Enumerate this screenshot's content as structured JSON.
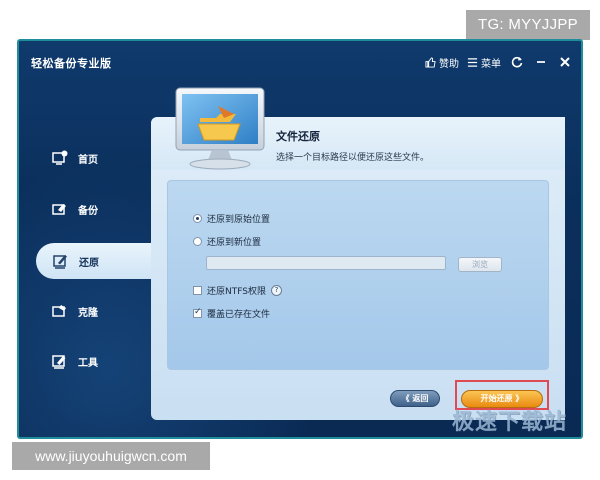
{
  "watermark": {
    "tag": "TG: MYYJJPP",
    "url": "www.jiuyouhuigwcn.com",
    "site": "极速下载站"
  },
  "app": {
    "title": "轻松备份专业版",
    "actions": {
      "donate": "赞助",
      "menu": "菜单"
    },
    "window_icons": [
      "refresh-icon",
      "minimize-icon",
      "close-icon"
    ]
  },
  "sidebar": {
    "items": [
      {
        "label": "首页",
        "icon": "home-icon",
        "active": false
      },
      {
        "label": "备份",
        "icon": "backup-icon",
        "active": false
      },
      {
        "label": "还原",
        "icon": "restore-icon",
        "active": true
      },
      {
        "label": "克隆",
        "icon": "clone-icon",
        "active": false
      },
      {
        "label": "工具",
        "icon": "tools-icon",
        "active": false
      }
    ]
  },
  "header": {
    "title": "文件还原",
    "subtitle": "选择一个目标路径以便还原这些文件。"
  },
  "options": {
    "restore_original": "还原到原始位置",
    "restore_new": "还原到新位置",
    "path_value": "",
    "browse": "浏览",
    "ntfs": "还原NTFS权限",
    "overwrite": "覆盖已存在文件",
    "help": "?"
  },
  "buttons": {
    "back": "《 返回",
    "start": "开始还原 》"
  },
  "colors": {
    "accent": "#e98a10",
    "frame": "#1f8e9a",
    "highlight": "#e04a53"
  }
}
